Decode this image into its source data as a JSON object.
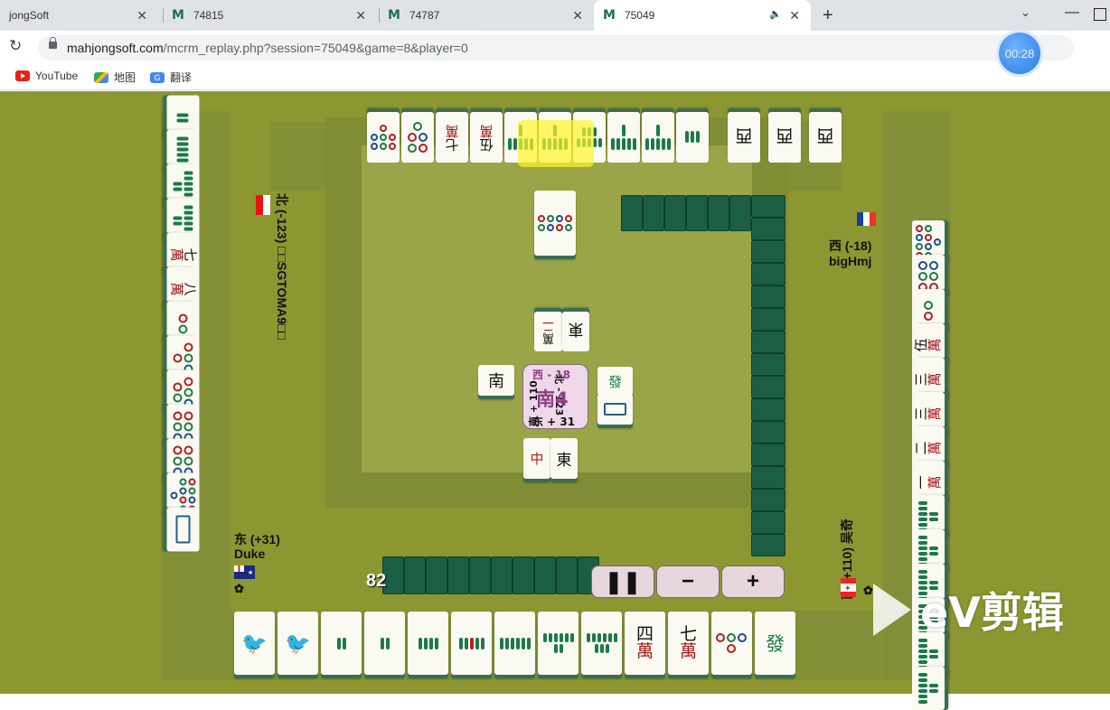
{
  "browser": {
    "tabs": [
      {
        "title": "jongSoft",
        "close": "✕"
      },
      {
        "title": "74815",
        "close": "✕"
      },
      {
        "title": "74787",
        "close": "✕"
      },
      {
        "title": "75049",
        "close": "✕",
        "active": true
      }
    ],
    "new_tab": "+",
    "url_domain": "mahjongsoft.com",
    "url_path": "/mcrm_replay.php?session=75049&game=8&player=0",
    "timer": "00:28",
    "bookmarks": [
      {
        "label": "YouTube",
        "icon": "youtube-icon"
      },
      {
        "label": "地图",
        "icon": "maps-icon"
      },
      {
        "label": "翻译",
        "icon": "translate-icon"
      }
    ]
  },
  "players": {
    "north": {
      "label": "北 (-123) □□SGTOMA9□□",
      "flag": "singapore"
    },
    "west": {
      "wind_score": "西 (-18)",
      "name": "bigHmj",
      "flag": "france"
    },
    "east": {
      "wind_score": "东 (+31)",
      "name": "Duke",
      "flag": "australia",
      "dealer_mark": "✿"
    },
    "south": {
      "label": "南 (+110) 吴奇",
      "flag": "canada",
      "dealer_mark": "✿"
    }
  },
  "round_indicator": {
    "center": "南4",
    "west": "西 - 18",
    "north": "北 - 123",
    "south": "南 + 110",
    "east": "东 + 31"
  },
  "wall_count": "82",
  "controls": {
    "pause": "❚❚",
    "minus": "−",
    "plus": "+"
  },
  "watermark": "eV剪辑",
  "discards": {
    "north_center": [
      "萬|二",
      "東"
    ],
    "west_center": [
      "南"
    ],
    "east_center": [
      "發",
      "白"
    ],
    "south_center": [
      "中",
      "東"
    ]
  },
  "hand_south": [
    "bird",
    "bird",
    "s2",
    "s2",
    "s4",
    "s5",
    "s6",
    "s8",
    "s9",
    "四|萬",
    "七|萬",
    "p4",
    "發"
  ],
  "melds_top": [
    "p7",
    "p5",
    "七|萬",
    "伍|萬",
    "s6",
    "s6",
    "s8",
    "s6",
    "s6",
    "s3",
    "西",
    "西",
    "西"
  ],
  "left_column": [
    "s2",
    "s6",
    "s8",
    "s8",
    "七|萬",
    "八|萬",
    "p2",
    "p4",
    "p5",
    "p6",
    "p6",
    "p9",
    "白"
  ],
  "right_column": [
    "p9",
    "p6",
    "p2",
    "伍|萬",
    "三|萬",
    "三|萬",
    "二|萬",
    "一|萬",
    "s8",
    "s8",
    "s8",
    "s8",
    "s8",
    "s8"
  ],
  "colors": {
    "table": "#8c9732",
    "tile_back": "#1c5e44",
    "highlight": "#fff528"
  }
}
